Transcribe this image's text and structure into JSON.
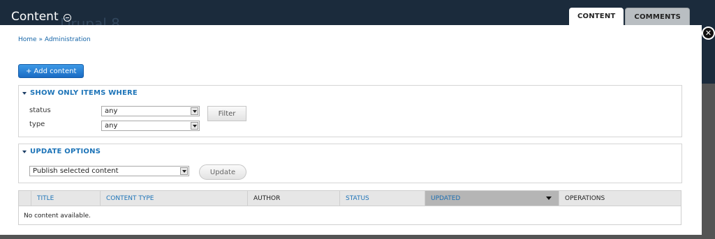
{
  "header": {
    "title": "Content",
    "background_text": "Drupal 8",
    "tabs": [
      {
        "label": "CONTENT",
        "active": true
      },
      {
        "label": "COMMENTS",
        "active": false
      }
    ]
  },
  "breadcrumb": {
    "home": "Home",
    "separator": "»",
    "current": "Administration"
  },
  "actions": {
    "add_content": "+ Add content"
  },
  "filter": {
    "legend": "SHOW ONLY ITEMS WHERE",
    "status_label": "status",
    "status_value": "any",
    "type_label": "type",
    "type_value": "any",
    "button": "Filter"
  },
  "update": {
    "legend": "UPDATE OPTIONS",
    "operation_value": "Publish selected content",
    "button": "Update"
  },
  "table": {
    "columns": [
      "TITLE",
      "CONTENT TYPE",
      "AUTHOR",
      "STATUS",
      "UPDATED",
      "OPERATIONS"
    ],
    "sorted_column": "UPDATED",
    "empty_text": "No content available."
  },
  "colors": {
    "toolbar_bg": "#1b2b3c",
    "link": "#1d74b8",
    "primary_button": "#1a6bc4"
  }
}
